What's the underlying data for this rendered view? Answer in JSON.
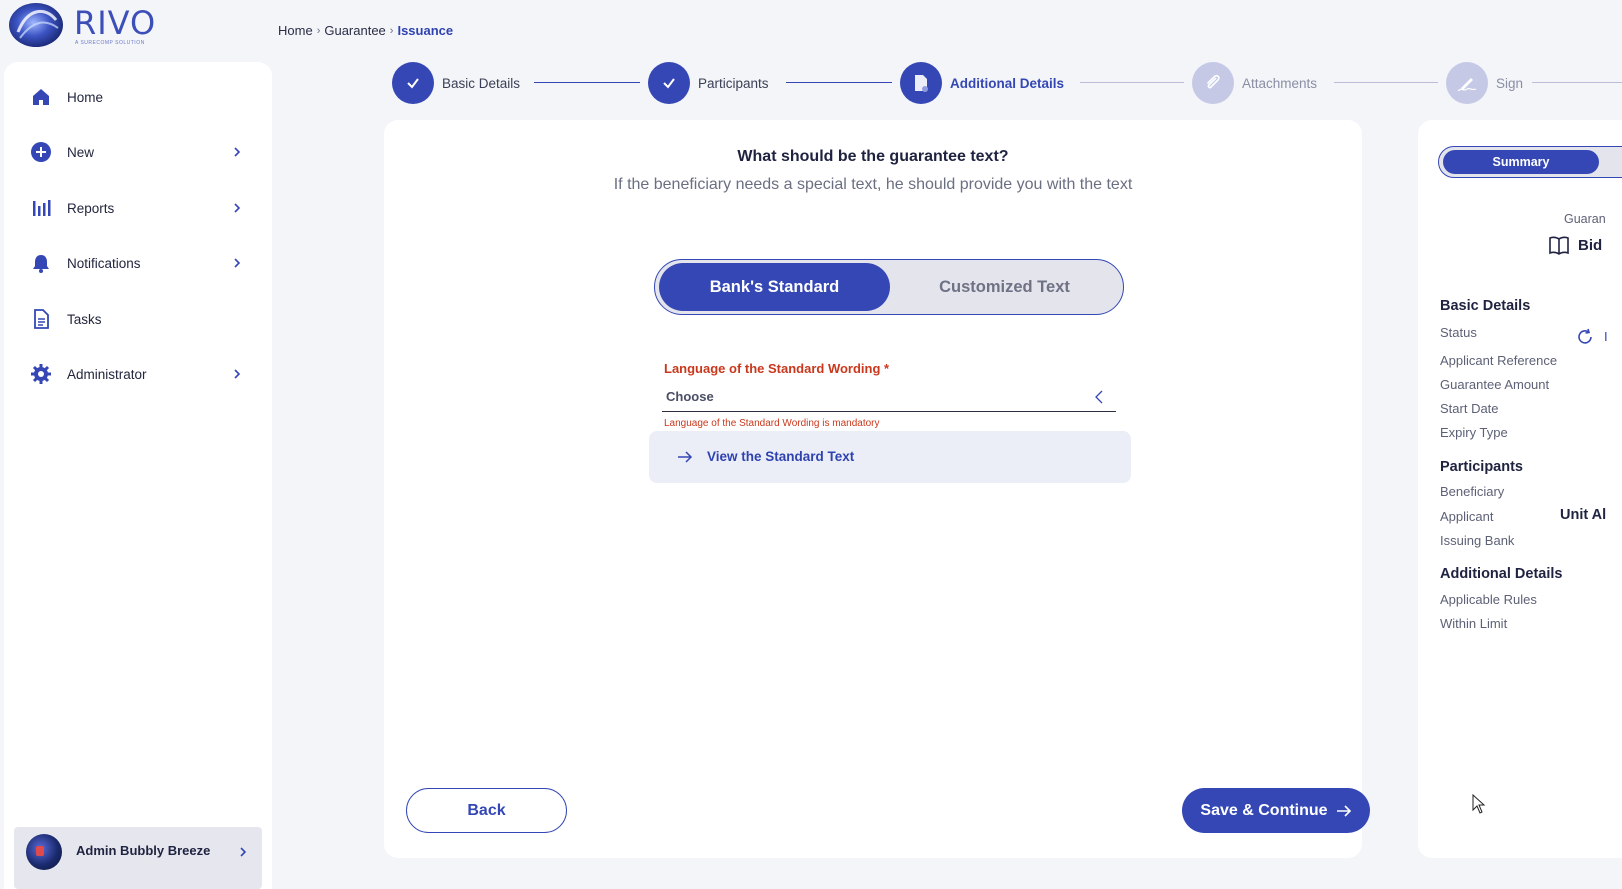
{
  "brand": {
    "name": "RIVO",
    "tagline": "A SURECOMP SOLUTION",
    "accent": "#3447b5",
    "error": "#c9381c"
  },
  "breadcrumb": {
    "items": [
      "Home",
      "Guarantee"
    ],
    "current": "Issuance"
  },
  "sidebar": {
    "items": [
      {
        "label": "Home",
        "icon": "home-icon",
        "has_submenu": false
      },
      {
        "label": "New",
        "icon": "plus-circle-icon",
        "has_submenu": true
      },
      {
        "label": "Reports",
        "icon": "bar-chart-icon",
        "has_submenu": true
      },
      {
        "label": "Notifications",
        "icon": "bell-icon",
        "has_submenu": true
      },
      {
        "label": "Tasks",
        "icon": "document-icon",
        "has_submenu": false
      },
      {
        "label": "Administrator",
        "icon": "gear-icon",
        "has_submenu": true
      }
    ],
    "user": {
      "name": "Admin Bubbly Breeze"
    }
  },
  "stepper": {
    "steps": [
      {
        "label": "Basic Details",
        "state": "done"
      },
      {
        "label": "Participants",
        "state": "done"
      },
      {
        "label": "Additional Details",
        "state": "active"
      },
      {
        "label": "Attachments",
        "state": "todo"
      },
      {
        "label": "Sign",
        "state": "todo"
      }
    ]
  },
  "main": {
    "question": "What should be the guarantee text?",
    "subtitle": "If the beneficiary needs a special text, he should provide you with the text",
    "toggle": {
      "selected": "Bank's Standard",
      "other": "Customized Text"
    },
    "language_field": {
      "label": "Language of the Standard Wording *",
      "value": "Choose",
      "error": "Language of the Standard Wording is mandatory"
    },
    "view_standard_text": "View the Standard Text",
    "back_label": "Back",
    "save_label": "Save & Continue"
  },
  "summary": {
    "tab": "Summary",
    "guarantee_label": "Guaran",
    "guarantee_type": "Bid",
    "sections": [
      {
        "title": "Basic Details",
        "rows": [
          "Status",
          "Applicant Reference",
          "Guarantee Amount",
          "Start Date",
          "Expiry Type"
        ]
      },
      {
        "title": "Participants",
        "rows": [
          "Beneficiary",
          "Applicant",
          "Issuing Bank"
        ]
      },
      {
        "title": "Additional Details",
        "rows": [
          "Applicable Rules",
          "Within Limit"
        ]
      }
    ],
    "status_value_fragment": "I",
    "applicant_value": "Unit Al"
  }
}
